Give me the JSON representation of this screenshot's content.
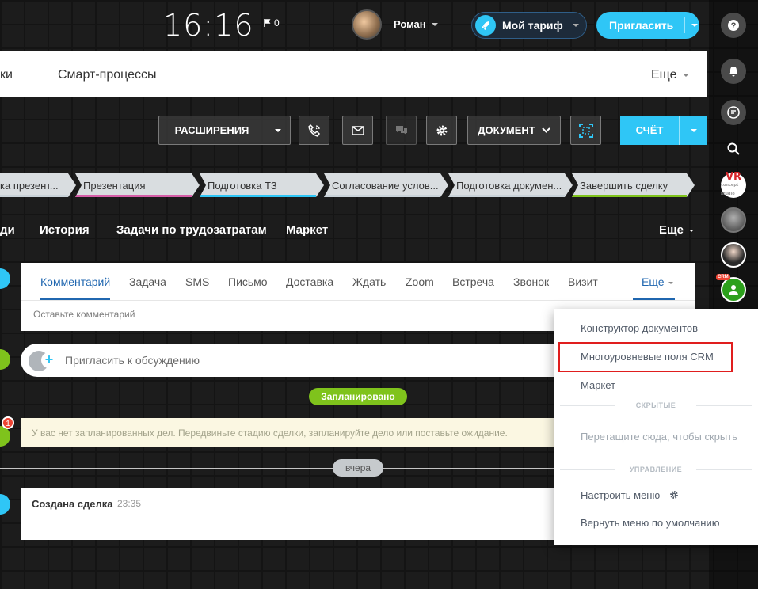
{
  "header": {
    "clock": "16:16",
    "flag_count": "0",
    "user_name": "Роман",
    "tariff_label": "Мой тариф",
    "invite_label": "Пригласить"
  },
  "top_tabs": {
    "partial_left": "ки",
    "smart_processes": "Смарт-процессы",
    "more": "Еще"
  },
  "toolbar": {
    "extensions": "РАСШИРЕНИЯ",
    "document": "ДОКУМЕНТ",
    "bill": "СЧЁТ"
  },
  "stages": [
    {
      "label": "ка презент...",
      "color": "#c9d2d8"
    },
    {
      "label": "Презентация",
      "color": "#d65ea8"
    },
    {
      "label": "Подготовка ТЗ",
      "color": "#2fc6f6"
    },
    {
      "label": "Согласование услов...",
      "color": "#c9d2d8"
    },
    {
      "label": "Подготовка докумен...",
      "color": "#c9d2d8"
    },
    {
      "label": "Завершить сделку",
      "color": "#7fc31c"
    }
  ],
  "detail_tabs": {
    "partial": "ди",
    "history": "История",
    "tasks_labor": "Задачи по трудозатратам",
    "market": "Маркет",
    "more": "Еще"
  },
  "editor": {
    "tabs": [
      "Комментарий",
      "Задача",
      "SMS",
      "Письмо",
      "Доставка",
      "Ждать",
      "Zoom",
      "Встреча",
      "Звонок",
      "Визит"
    ],
    "more": "Еще",
    "placeholder": "Оставьте комментарий"
  },
  "invite_discussion": "Пригласить к обсуждению",
  "timeline": {
    "planned_badge": "Запланировано",
    "counter": "1",
    "empty_text": "У вас нет запланированных дел. Передвиньте стадию сделки, запланируйте дело или поставьте ожидание.",
    "yesterday_badge": "вчера",
    "created_title": "Создана сделка",
    "created_time": "23:35"
  },
  "dropdown": {
    "items": {
      "doc_builder": "Конструктор документов",
      "multilevel": "Многоуровневые поля CRM",
      "market": "Маркет"
    },
    "hidden_section": "СКРЫТЫЕ",
    "drag_hint": "Перетащите сюда, чтобы скрыть",
    "manage_section": "УПРАВЛЕНИЕ",
    "configure": "Настроить меню",
    "reset": "Вернуть меню по умолчанию"
  },
  "sidebar": {
    "vr_logo": "VR",
    "vr_sub": "concept studio",
    "crm_tag": "CRM"
  },
  "colors": {
    "accent": "#2fc6f6",
    "green": "#7fc31c",
    "link": "#2067b0",
    "highlight": "#e01e1e"
  }
}
